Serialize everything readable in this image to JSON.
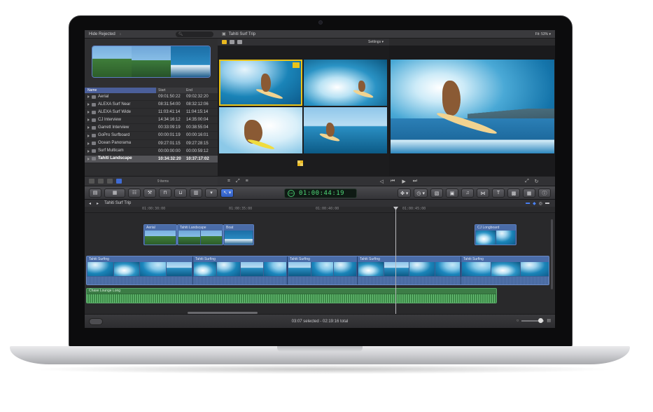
{
  "library": {
    "filter": "Hide Rejected",
    "columns": {
      "name": "Name",
      "start": "Start",
      "end": "End"
    },
    "clips": [
      {
        "name": "Aerial",
        "start": "09:01:50:22",
        "end": "09:02:32:20"
      },
      {
        "name": "ALEXA Surf Near",
        "start": "08:31:54:00",
        "end": "08:32:12:06"
      },
      {
        "name": "ALEXA Surf Wide",
        "start": "11:03:41:14",
        "end": "11:04:15:14"
      },
      {
        "name": "CJ Interview",
        "start": "14:34:16:12",
        "end": "14:35:00:04"
      },
      {
        "name": "Garrett Interview",
        "start": "00:33:09:19",
        "end": "00:38:55:04"
      },
      {
        "name": "GoPro Surfboard",
        "start": "00:00:01:19",
        "end": "00:00:16:01"
      },
      {
        "name": "Ocean Panorama",
        "start": "09:27:01:15",
        "end": "09:27:28:15"
      },
      {
        "name": "Surf Multicam",
        "start": "00:00:00:00",
        "end": "00:00:59:12"
      },
      {
        "name": "Tahiti Landscape",
        "start": "10:34:32:20",
        "end": "10:37:17:02",
        "selected": true
      }
    ],
    "item_count": "9 items"
  },
  "viewer": {
    "title": "Tahiti Surf Trip",
    "settings_label": "Settings",
    "fit_label": "Fit:",
    "fit_value": "53%"
  },
  "toolbar": {
    "timecode": "01:00:44:19",
    "timecode_dial": "100"
  },
  "timeline": {
    "project": "Tahiti Surf Trip",
    "ruler": [
      "01:00:30:00",
      "01:00:35:00",
      "01:00:40:00",
      "01:00:45:00"
    ],
    "connected_clips": [
      "Aerial",
      "Tahiti Landscape",
      "Boat",
      "CJ Longboard"
    ],
    "primary_clips": [
      "Tahiti Surfing",
      "Tahiti Surfing",
      "Tahiti Surfing",
      "Tahiti Surfing",
      "Tahiti Surfing"
    ],
    "audio_clip": "Chase Lounge Long"
  },
  "status": {
    "text": "03:07 selected - 02:19:16 total"
  },
  "colors": {
    "accent": "#3f6bd4",
    "selection_yellow": "#e9c41a",
    "timecode_green": "#4fd878",
    "audio_green": "#2f6a38"
  }
}
